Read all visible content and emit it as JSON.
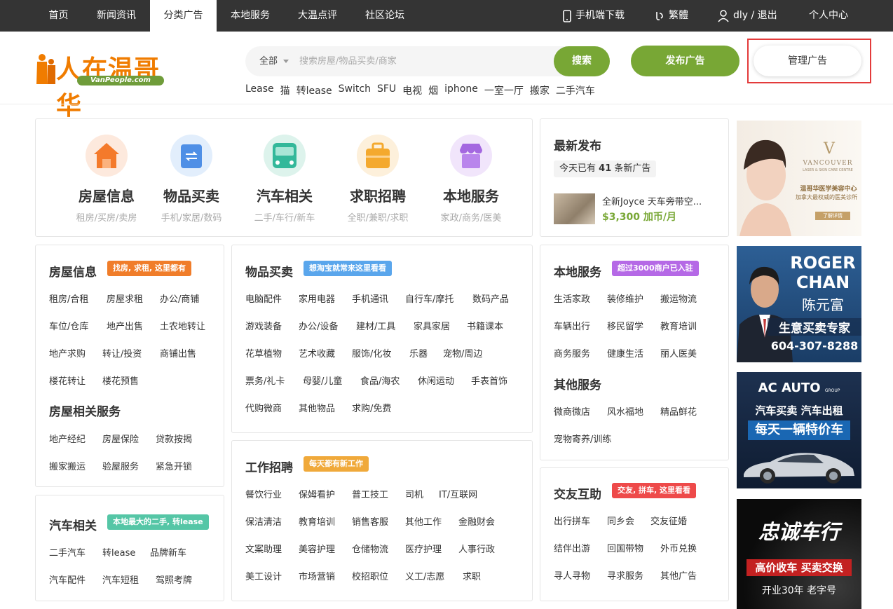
{
  "topnav": {
    "items": [
      "首页",
      "新闻资讯",
      "分类广告",
      "本地服务",
      "大温点评",
      "社区论坛"
    ],
    "right": {
      "mobile": "手机端下载",
      "lang": "繁體",
      "user": "dly / 退出",
      "center": "个人中心"
    }
  },
  "logo": {
    "text": "人在温哥华",
    "sub": "VanPeople.com"
  },
  "search": {
    "scope": "全部",
    "placeholder": "搜索房屋/物品买卖/商家",
    "button": "搜索"
  },
  "hot_keywords": [
    "Lease",
    "猫",
    "转lease",
    "Switch",
    "SFU",
    "电视",
    "烟",
    "iphone",
    "一室一厅",
    "搬家",
    "二手汽车"
  ],
  "actions": {
    "post": "发布广告",
    "manage": "管理广告"
  },
  "categories": [
    {
      "name": "房屋信息",
      "sub": "租房/买房/卖房"
    },
    {
      "name": "物品买卖",
      "sub": "手机/家居/数码"
    },
    {
      "name": "汽车相关",
      "sub": "二手/车行/新车"
    },
    {
      "name": "求职招聘",
      "sub": "全职/兼职/求职"
    },
    {
      "name": "本地服务",
      "sub": "家政/商务/医美"
    }
  ],
  "latest": {
    "title": "最新发布",
    "today_prefix": "今天已有",
    "today_count": "41",
    "today_suffix": "条新广告",
    "post_title": "全新Joyce 天车旁带空...",
    "post_price": "$3,300 加币/月"
  },
  "housing": {
    "title": "房屋信息",
    "badge": "找房, 求租, 这里都有",
    "links": [
      "租房/合租",
      "房屋求租",
      "办公/商铺",
      "车位/仓库",
      "地产出售",
      "土农地转让",
      "地产求购",
      "转让/投资",
      "商铺出售",
      "楼花转让",
      "楼花预售"
    ],
    "related_title": "房屋相关服务",
    "related_links": [
      "地产经纪",
      "房屋保险",
      "贷款按揭",
      "搬家搬运",
      "验屋服务",
      "紧急开锁"
    ]
  },
  "cars": {
    "title": "汽车相关",
    "badge": "本地最大的二手, 转lease",
    "links": [
      "二手汽车",
      "转lease",
      "品牌新车",
      "汽车配件",
      "汽车短租",
      "驾照考牌"
    ]
  },
  "goods": {
    "title": "物品买卖",
    "badge": "想淘宝就常来这里看看",
    "links": [
      "电脑配件",
      "家用电器",
      "手机通讯",
      "自行车/摩托",
      "数码产品",
      "游戏装备",
      "办公/设备",
      "建材/工具",
      "家具家居",
      "书籍课本",
      "花草植物",
      "艺术收藏",
      "服饰/化妆",
      "乐器",
      "宠物/周边",
      "票务/礼卡",
      "母婴/儿童",
      "食品/海农",
      "休闲运动",
      "手表首饰",
      "代购微商",
      "其他物品",
      "求购/免费"
    ]
  },
  "jobs": {
    "title": "工作招聘",
    "badge": "每天都有新工作",
    "links": [
      "餐饮行业",
      "保姆看护",
      "普工技工",
      "司机",
      "IT/互联网",
      "保洁清洁",
      "教育培训",
      "销售客服",
      "其他工作",
      "金融财会",
      "文案助理",
      "美容护理",
      "仓储物流",
      "医疗护理",
      "人事行政",
      "美工设计",
      "市场营销",
      "校招职位",
      "义工/志愿",
      "求职"
    ]
  },
  "services": {
    "title": "本地服务",
    "badge": "超过3000商户已入驻",
    "links": [
      "生活家政",
      "装修维护",
      "搬运物流",
      "车辆出行",
      "移民留学",
      "教育培训",
      "商务服务",
      "健康生活",
      "丽人医美"
    ],
    "other_title": "其他服务",
    "other_links": [
      "微商微店",
      "风水福地",
      "精品鲜花",
      "宠物寄养/训练"
    ]
  },
  "social": {
    "title": "交友互助",
    "badge": "交友, 拼车, 这里看看",
    "links": [
      "出行拼车",
      "同乡会",
      "交友征婚",
      "结伴出游",
      "回国带物",
      "外币兑换",
      "寻人寻物",
      "寻求服务",
      "其他广告"
    ]
  },
  "ads": {
    "ad1": {
      "brand": "VANCOUVER",
      "brand_sub": "LASER & SKIN CARE CENTRE",
      "line1": "温哥华医学美容中心",
      "line2": "加拿大最权威的医美诊所",
      "btn": "了解详情"
    },
    "ad2": {
      "name1": "ROGER",
      "name2": "CHAN",
      "cn": "陈元富",
      "tag": "生意买卖专家",
      "phone": "604-307-8288"
    },
    "ad3": {
      "brand": "AC AUTO",
      "group": "GROUP",
      "line1": "汽车买卖 汽车出租",
      "line2": "每天一辆特价车"
    },
    "ad4": {
      "title": "忠诚车行",
      "tag": "高价收车 买卖交换",
      "line": "开业30年 老字号"
    }
  },
  "colors": {
    "green": "#78a735",
    "orange": "#f07c00",
    "nav_bg": "#343434",
    "badge_orange": "#f07d2a",
    "badge_blue": "#5aa6ec",
    "badge_teal": "#55c6a6",
    "badge_gold": "#f0a93a",
    "badge_purple": "#b569e6",
    "badge_red": "#ee4a4a",
    "highlight_red": "#e33b3b"
  }
}
